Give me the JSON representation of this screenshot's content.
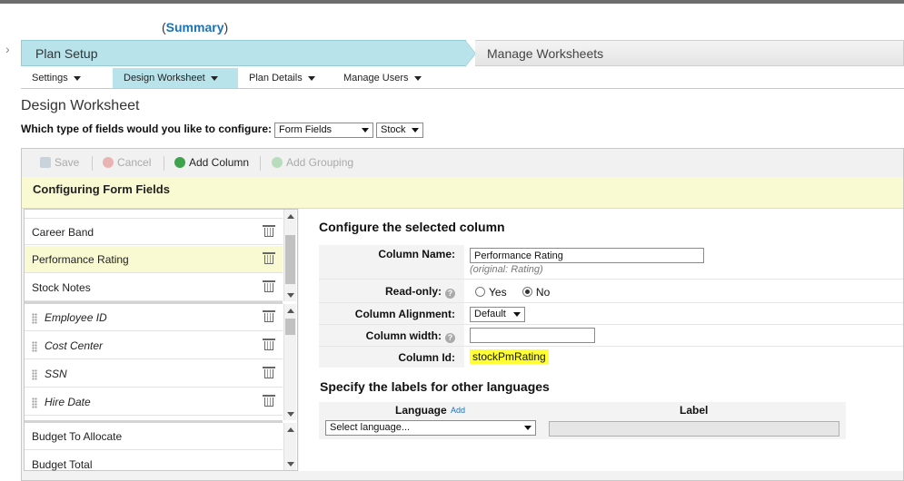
{
  "header": {
    "summary_open": "(",
    "summary_link": "Summary",
    "summary_close": ")"
  },
  "steps": {
    "active": "Plan Setup",
    "next": "Manage Worksheets"
  },
  "subtabs": [
    {
      "label": "Settings"
    },
    {
      "label": "Design Worksheet"
    },
    {
      "label": "Plan Details"
    },
    {
      "label": "Manage Users"
    }
  ],
  "page": {
    "title": "Design Worksheet",
    "fieldtype_question": "Which type of fields would you like to configure:",
    "fieldtype_value": "Form Fields",
    "category_value": "Stock"
  },
  "toolbar": {
    "save": "Save",
    "cancel": "Cancel",
    "add_column": "Add Column",
    "add_grouping": "Add Grouping"
  },
  "banner": "Configuring Form Fields",
  "list": {
    "group1": [
      {
        "label": "Career Band"
      },
      {
        "label": "Performance Rating"
      },
      {
        "label": "Stock Notes"
      }
    ],
    "group2": [
      {
        "label": "Employee ID"
      },
      {
        "label": "Cost Center"
      },
      {
        "label": "SSN"
      },
      {
        "label": "Hire Date"
      }
    ],
    "group3": [
      {
        "label": "Budget To Allocate"
      },
      {
        "label": "Budget Total"
      }
    ]
  },
  "configure": {
    "title": "Configure the selected column",
    "column_name_label": "Column Name:",
    "column_name_value": "Performance Rating",
    "column_name_original": "(original: Rating)",
    "readonly_label": "Read-only:",
    "readonly_yes": "Yes",
    "readonly_no": "No",
    "alignment_label": "Column Alignment:",
    "alignment_value": "Default",
    "width_label": "Column width:",
    "width_value": "",
    "id_label": "Column Id:",
    "id_value": "stockPmRating"
  },
  "languages": {
    "title": "Specify the labels for other languages",
    "language_header": "Language",
    "add_link": "Add",
    "label_header": "Label",
    "select_placeholder": "Select language..."
  }
}
